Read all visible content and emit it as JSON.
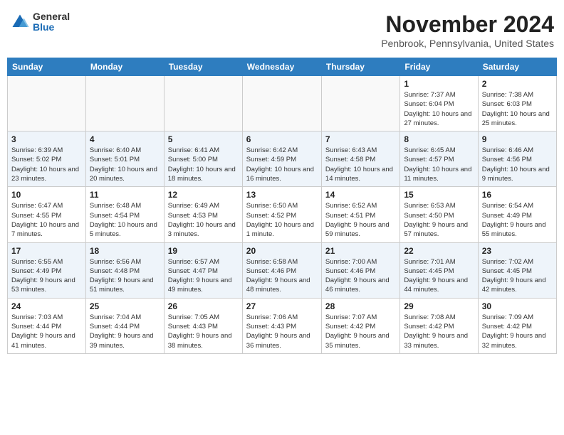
{
  "logo": {
    "general": "General",
    "blue": "Blue"
  },
  "header": {
    "month_title": "November 2024",
    "location": "Penbrook, Pennsylvania, United States"
  },
  "weekdays": [
    "Sunday",
    "Monday",
    "Tuesday",
    "Wednesday",
    "Thursday",
    "Friday",
    "Saturday"
  ],
  "weeks": [
    [
      {
        "day": "",
        "info": ""
      },
      {
        "day": "",
        "info": ""
      },
      {
        "day": "",
        "info": ""
      },
      {
        "day": "",
        "info": ""
      },
      {
        "day": "",
        "info": ""
      },
      {
        "day": "1",
        "info": "Sunrise: 7:37 AM\nSunset: 6:04 PM\nDaylight: 10 hours and 27 minutes."
      },
      {
        "day": "2",
        "info": "Sunrise: 7:38 AM\nSunset: 6:03 PM\nDaylight: 10 hours and 25 minutes."
      }
    ],
    [
      {
        "day": "3",
        "info": "Sunrise: 6:39 AM\nSunset: 5:02 PM\nDaylight: 10 hours and 23 minutes."
      },
      {
        "day": "4",
        "info": "Sunrise: 6:40 AM\nSunset: 5:01 PM\nDaylight: 10 hours and 20 minutes."
      },
      {
        "day": "5",
        "info": "Sunrise: 6:41 AM\nSunset: 5:00 PM\nDaylight: 10 hours and 18 minutes."
      },
      {
        "day": "6",
        "info": "Sunrise: 6:42 AM\nSunset: 4:59 PM\nDaylight: 10 hours and 16 minutes."
      },
      {
        "day": "7",
        "info": "Sunrise: 6:43 AM\nSunset: 4:58 PM\nDaylight: 10 hours and 14 minutes."
      },
      {
        "day": "8",
        "info": "Sunrise: 6:45 AM\nSunset: 4:57 PM\nDaylight: 10 hours and 11 minutes."
      },
      {
        "day": "9",
        "info": "Sunrise: 6:46 AM\nSunset: 4:56 PM\nDaylight: 10 hours and 9 minutes."
      }
    ],
    [
      {
        "day": "10",
        "info": "Sunrise: 6:47 AM\nSunset: 4:55 PM\nDaylight: 10 hours and 7 minutes."
      },
      {
        "day": "11",
        "info": "Sunrise: 6:48 AM\nSunset: 4:54 PM\nDaylight: 10 hours and 5 minutes."
      },
      {
        "day": "12",
        "info": "Sunrise: 6:49 AM\nSunset: 4:53 PM\nDaylight: 10 hours and 3 minutes."
      },
      {
        "day": "13",
        "info": "Sunrise: 6:50 AM\nSunset: 4:52 PM\nDaylight: 10 hours and 1 minute."
      },
      {
        "day": "14",
        "info": "Sunrise: 6:52 AM\nSunset: 4:51 PM\nDaylight: 9 hours and 59 minutes."
      },
      {
        "day": "15",
        "info": "Sunrise: 6:53 AM\nSunset: 4:50 PM\nDaylight: 9 hours and 57 minutes."
      },
      {
        "day": "16",
        "info": "Sunrise: 6:54 AM\nSunset: 4:49 PM\nDaylight: 9 hours and 55 minutes."
      }
    ],
    [
      {
        "day": "17",
        "info": "Sunrise: 6:55 AM\nSunset: 4:49 PM\nDaylight: 9 hours and 53 minutes."
      },
      {
        "day": "18",
        "info": "Sunrise: 6:56 AM\nSunset: 4:48 PM\nDaylight: 9 hours and 51 minutes."
      },
      {
        "day": "19",
        "info": "Sunrise: 6:57 AM\nSunset: 4:47 PM\nDaylight: 9 hours and 49 minutes."
      },
      {
        "day": "20",
        "info": "Sunrise: 6:58 AM\nSunset: 4:46 PM\nDaylight: 9 hours and 48 minutes."
      },
      {
        "day": "21",
        "info": "Sunrise: 7:00 AM\nSunset: 4:46 PM\nDaylight: 9 hours and 46 minutes."
      },
      {
        "day": "22",
        "info": "Sunrise: 7:01 AM\nSunset: 4:45 PM\nDaylight: 9 hours and 44 minutes."
      },
      {
        "day": "23",
        "info": "Sunrise: 7:02 AM\nSunset: 4:45 PM\nDaylight: 9 hours and 42 minutes."
      }
    ],
    [
      {
        "day": "24",
        "info": "Sunrise: 7:03 AM\nSunset: 4:44 PM\nDaylight: 9 hours and 41 minutes."
      },
      {
        "day": "25",
        "info": "Sunrise: 7:04 AM\nSunset: 4:44 PM\nDaylight: 9 hours and 39 minutes."
      },
      {
        "day": "26",
        "info": "Sunrise: 7:05 AM\nSunset: 4:43 PM\nDaylight: 9 hours and 38 minutes."
      },
      {
        "day": "27",
        "info": "Sunrise: 7:06 AM\nSunset: 4:43 PM\nDaylight: 9 hours and 36 minutes."
      },
      {
        "day": "28",
        "info": "Sunrise: 7:07 AM\nSunset: 4:42 PM\nDaylight: 9 hours and 35 minutes."
      },
      {
        "day": "29",
        "info": "Sunrise: 7:08 AM\nSunset: 4:42 PM\nDaylight: 9 hours and 33 minutes."
      },
      {
        "day": "30",
        "info": "Sunrise: 7:09 AM\nSunset: 4:42 PM\nDaylight: 9 hours and 32 minutes."
      }
    ]
  ]
}
